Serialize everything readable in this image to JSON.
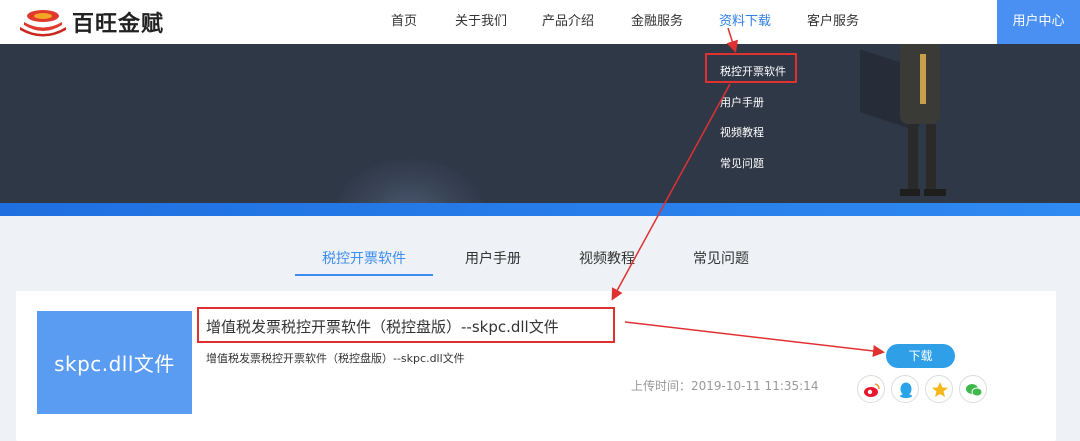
{
  "header": {
    "logo_text": "百旺金赋",
    "nav": [
      {
        "label": "首页",
        "active": false
      },
      {
        "label": "关于我们",
        "active": false
      },
      {
        "label": "产品介绍",
        "active": false
      },
      {
        "label": "金融服务",
        "active": false
      },
      {
        "label": "资料下载",
        "active": true
      },
      {
        "label": "客户服务",
        "active": false
      }
    ],
    "user_center": "用户中心"
  },
  "dropdown": {
    "items": [
      "税控开票软件",
      "用户手册",
      "视频教程",
      "常见问题"
    ]
  },
  "tabs": [
    {
      "label": "税控开票软件",
      "active": true
    },
    {
      "label": "用户手册",
      "active": false
    },
    {
      "label": "视频教程",
      "active": false
    },
    {
      "label": "常见问题",
      "active": false
    }
  ],
  "card": {
    "thumb_text": "skpc.dll文件",
    "title": "增值税发票税控开票软件（税控盘版）--skpc.dll文件",
    "description": "增值税发票税控开票软件（税控盘版）--skpc.dll文件",
    "upload_time": "上传时间：2019-10-11 11:35:14",
    "download_label": "下载",
    "share_icons": [
      "weibo-icon",
      "qq-icon",
      "qzone-star-icon",
      "wechat-icon"
    ]
  },
  "colors": {
    "accent": "#4a90f2",
    "banner": "#2f3847",
    "annotation": "#e03131",
    "download": "#2fa0e8"
  }
}
